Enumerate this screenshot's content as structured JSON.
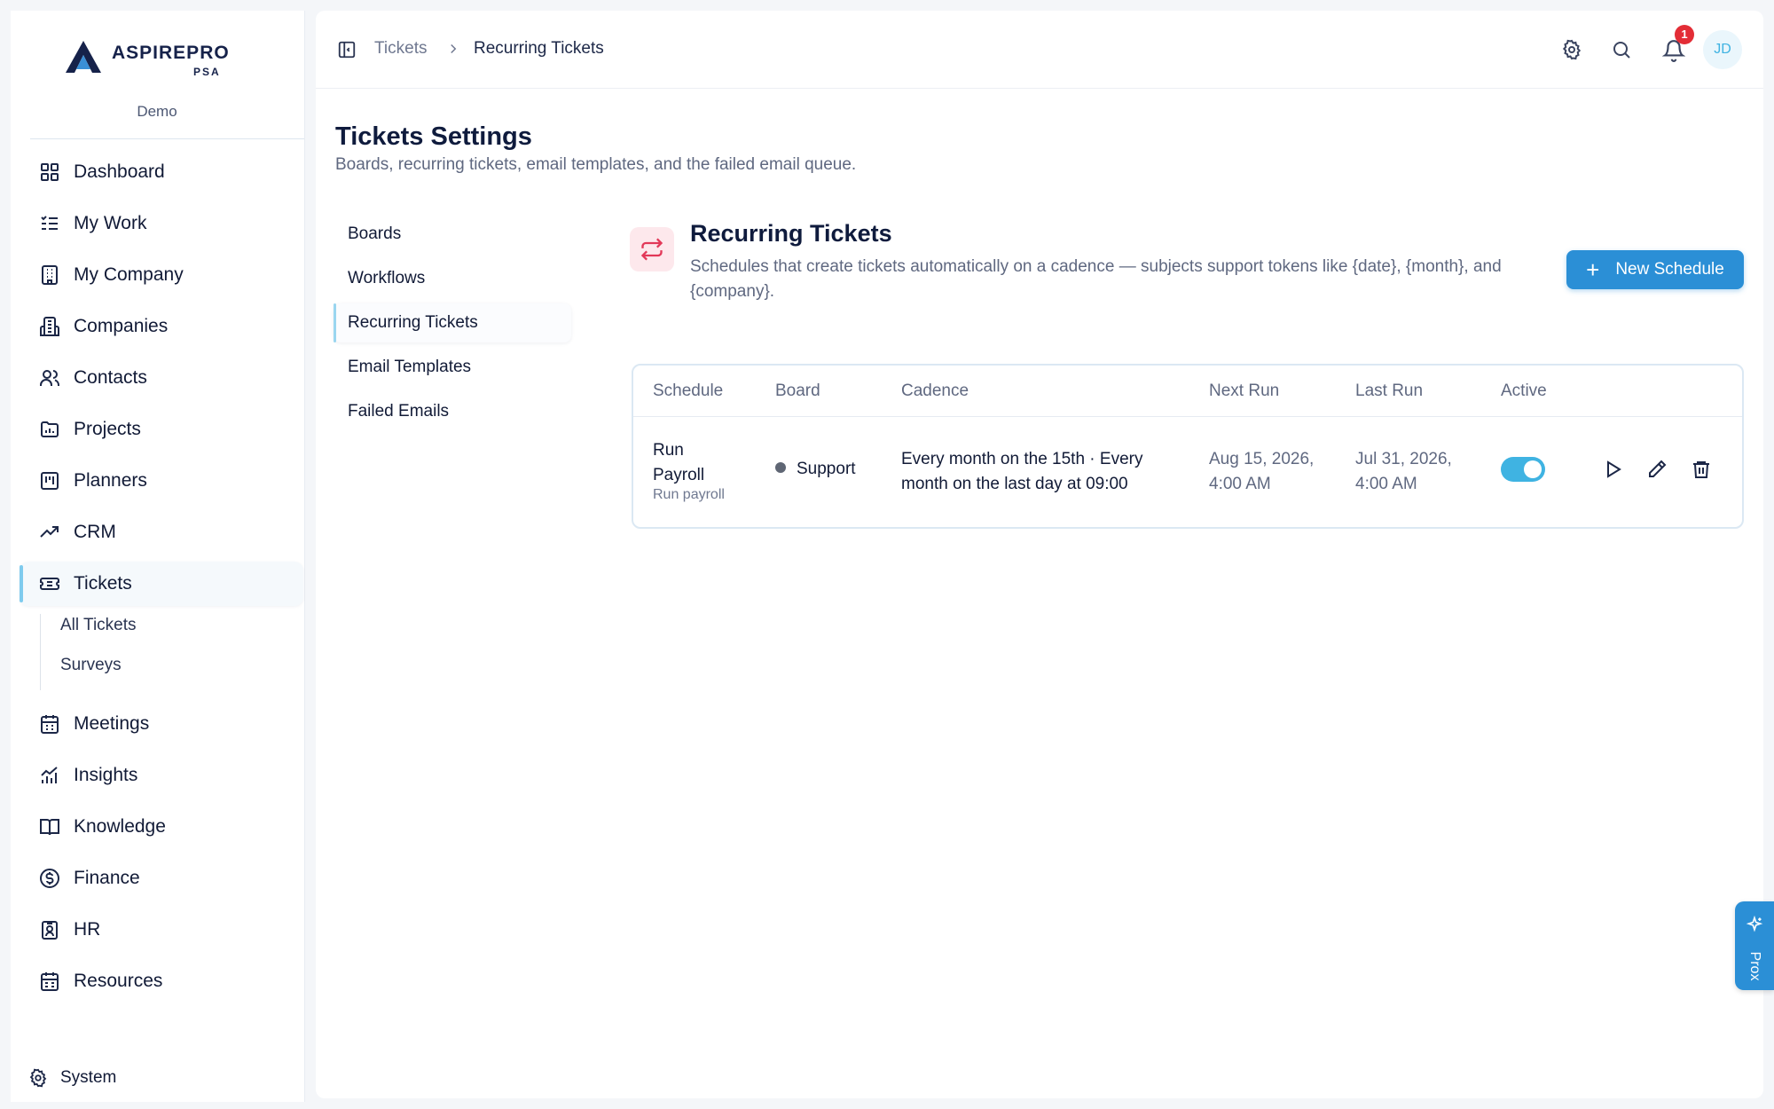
{
  "sidebar": {
    "logo_main": "ASPIREPRO",
    "logo_sub": "PSA",
    "tenant": "Demo",
    "items": [
      {
        "label": "Dashboard"
      },
      {
        "label": "My Work"
      },
      {
        "label": "My Company"
      },
      {
        "label": "Companies"
      },
      {
        "label": "Contacts"
      },
      {
        "label": "Projects"
      },
      {
        "label": "Planners"
      },
      {
        "label": "CRM"
      },
      {
        "label": "Tickets"
      },
      {
        "label": "Meetings"
      },
      {
        "label": "Insights"
      },
      {
        "label": "Knowledge"
      },
      {
        "label": "Finance"
      },
      {
        "label": "HR"
      },
      {
        "label": "Resources"
      }
    ],
    "sub_items": [
      {
        "label": "All Tickets"
      },
      {
        "label": "Surveys"
      }
    ],
    "system_label": "System"
  },
  "topbar": {
    "breadcrumb_parent": "Tickets",
    "breadcrumb_current": "Recurring Tickets",
    "notification_count": "1",
    "avatar_initials": "JD"
  },
  "page": {
    "title": "Tickets Settings",
    "subtitle": "Boards, recurring tickets, email templates, and the failed email queue."
  },
  "settings_nav": [
    {
      "label": "Boards"
    },
    {
      "label": "Workflows"
    },
    {
      "label": "Recurring Tickets"
    },
    {
      "label": "Email Templates"
    },
    {
      "label": "Failed Emails"
    }
  ],
  "section": {
    "title": "Recurring Tickets",
    "description": "Schedules that create tickets automatically on a cadence — subjects support tokens like {date}, {month}, and {company}.",
    "new_button_label": "New Schedule"
  },
  "table": {
    "columns": [
      "Schedule",
      "Board",
      "Cadence",
      "Next Run",
      "Last Run",
      "Active"
    ],
    "rows": [
      {
        "schedule_line1": "Run",
        "schedule_line2": "Payroll",
        "schedule_sub": "Run payroll",
        "board": "Support",
        "cadence_line1": "Every month on the 15th · Every",
        "cadence_line2": "month on the last day at 09:00",
        "next_run_line1": "Aug 15, 2026,",
        "next_run_line2": "4:00 AM",
        "last_run_line1": "Jul 31, 2026,",
        "last_run_line2": "4:00 AM",
        "active": true
      }
    ]
  },
  "assistant": {
    "label": "Prox"
  },
  "colors": {
    "accent": "#2b8fd6",
    "toggle_on": "#3fb3e2",
    "badge": "#e32d36",
    "section_icon_bg": "#fde8ec",
    "section_icon": "#e23858"
  }
}
